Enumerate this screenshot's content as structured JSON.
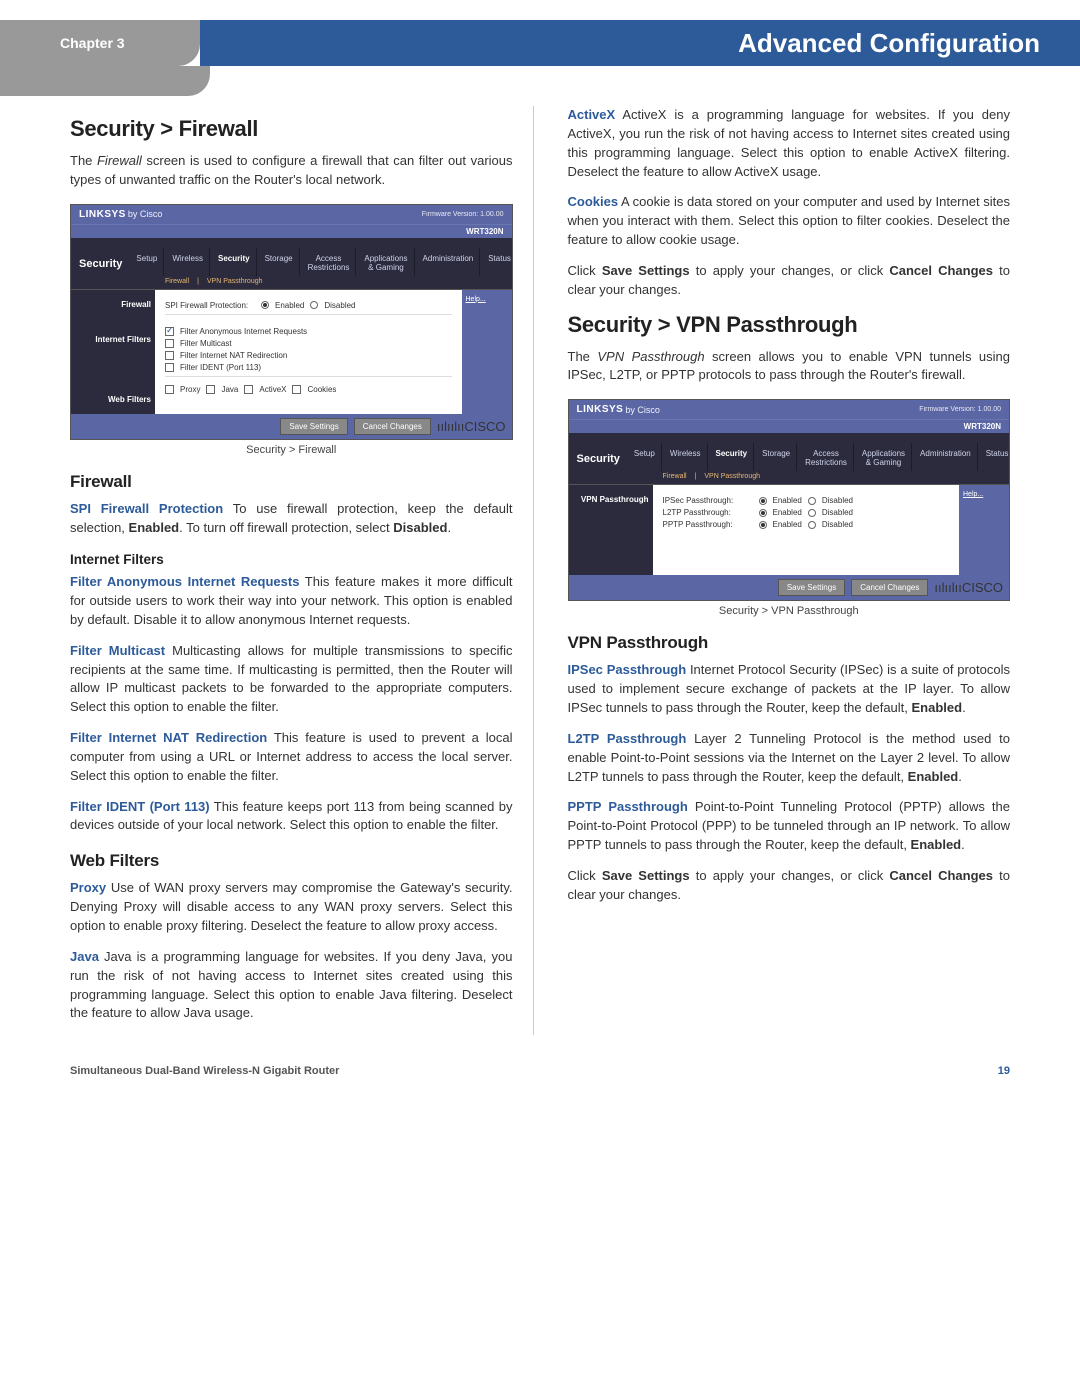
{
  "header": {
    "chapter": "Chapter 3",
    "title": "Advanced Configuration"
  },
  "left": {
    "h1": "Security > Firewall",
    "intro_a": "The ",
    "intro_em": "Firewall",
    "intro_b": " screen is used to configure a firewall that can filter out various types of unwanted traffic on the Router's local network.",
    "fig": {
      "brand": "LINKSYS",
      "by": "by Cisco",
      "fw": "Firmware Version: 1.00.00",
      "model": "WRT320N",
      "left_lbl": "Security",
      "tabs": [
        "Setup",
        "Wireless",
        "Security",
        "Storage",
        "Access Restrictions",
        "Applications & Gaming",
        "Administration",
        "Status"
      ],
      "subnav": [
        "Firewall",
        "|",
        "VPN Passthrough"
      ],
      "side": [
        "Firewall",
        "Internet Filters",
        "Web Filters"
      ],
      "spi_label": "SPI Firewall Protection:",
      "enabled": "Enabled",
      "disabled": "Disabled",
      "if1": "Filter Anonymous Internet Requests",
      "if2": "Filter Multicast",
      "if3": "Filter Internet NAT Redirection",
      "if4": "Filter IDENT (Port 113)",
      "wf": [
        "Proxy",
        "Java",
        "ActiveX",
        "Cookies"
      ],
      "help": "Help...",
      "save": "Save Settings",
      "cancel": "Cancel Changes",
      "cisco": "CISCO",
      "caption": "Security > Firewall"
    },
    "h2_firewall": "Firewall",
    "spi_term": "SPI Firewall Protection",
    "spi_body_a": " To use firewall protection, keep the default selection, ",
    "spi_en": "Enabled",
    "spi_body_b": ". To turn off firewall protection, select ",
    "spi_dis": "Disabled",
    "spi_body_c": ".",
    "h3_if": "Internet Filters",
    "fair_term": "Filter Anonymous Internet Requests",
    "fair_body": " This feature makes it more difficult for outside users to work their way into your network. This option is enabled by default. Disable it to allow anonymous Internet requests.",
    "fm_term": "Filter Multicast",
    "fm_body": " Multicasting allows for multiple transmissions to specific recipients at the same time. If multicasting is permitted, then the Router will allow IP multicast packets to be forwarded to the appropriate computers. Select this option to enable the filter.",
    "fnat_term": "Filter Internet NAT Redirection",
    "fnat_body": " This feature is used to prevent a local computer from using a URL or Internet address to access the local server. Select this option to enable the filter.",
    "fident_term": "Filter IDENT (Port 113)",
    "fident_body": " This feature keeps port 113 from being scanned by devices outside of your local network. Select this option to enable the filter.",
    "h2_wf": "Web Filters",
    "proxy_term": "Proxy",
    "proxy_body": " Use of WAN proxy servers may compromise the Gateway's security. Denying Proxy will disable access to any WAN proxy servers. Select this option to enable proxy filtering. Deselect the feature to allow proxy access.",
    "java_term": "Java",
    "java_body": " Java is a programming language for websites. If you deny Java, you run the risk of not having access to Internet sites created using this programming language. Select this option to enable Java filtering. Deselect the feature to allow Java usage."
  },
  "right": {
    "activex_term": "ActiveX",
    "activex_body": " ActiveX is a programming language for websites. If you deny ActiveX, you run the risk of not having access to Internet sites created using this programming language. Select this option to enable ActiveX filtering. Deselect the feature to allow ActiveX usage.",
    "cookies_term": "Cookies",
    "cookies_body": " A cookie is data stored on your computer and used by Internet sites when you interact with them. Select this option to filter cookies. Deselect the feature to allow cookie usage.",
    "save_a": "Click ",
    "save_b": "Save Settings",
    "save_c": " to apply your changes, or click ",
    "save_d": "Cancel Changes",
    "save_e": " to clear your changes.",
    "h1": "Security > VPN Passthrough",
    "intro_a": "The ",
    "intro_em": "VPN Passthrough",
    "intro_b": " screen allows you to enable VPN tunnels using IPSec, L2TP, or PPTP protocols to pass through the Router's firewall.",
    "fig": {
      "brand": "LINKSYS",
      "by": "by Cisco",
      "fw": "Firmware Version: 1.00.00",
      "model": "WRT320N",
      "left_lbl": "Security",
      "tabs": [
        "Setup",
        "Wireless",
        "Security",
        "Storage",
        "Access Restrictions",
        "Applications & Gaming",
        "Administration",
        "Status"
      ],
      "subnav": [
        "Firewall",
        "|",
        "VPN Passthrough"
      ],
      "side": [
        "VPN Passthrough"
      ],
      "rows": [
        {
          "label": "IPSec Passthrough:"
        },
        {
          "label": "L2TP Passthrough:"
        },
        {
          "label": "PPTP Passthrough:"
        }
      ],
      "enabled": "Enabled",
      "disabled": "Disabled",
      "help": "Help...",
      "save": "Save Settings",
      "cancel": "Cancel Changes",
      "cisco": "CISCO",
      "caption": "Security > VPN Passthrough"
    },
    "h2": "VPN Passthrough",
    "ipsec_term": "IPSec Passthrough",
    "ipsec_body_a": " Internet Protocol Security (IPSec) is a suite of protocols used to implement secure exchange of packets at the IP layer. To allow IPSec tunnels to pass through the Router, keep the default, ",
    "ipsec_en": "Enabled",
    "ipsec_body_b": ".",
    "l2tp_term": "L2TP Passthrough",
    "l2tp_body_a": " Layer 2 Tunneling Protocol is the method used to enable Point-to-Point sessions via the Internet on the Layer 2 level. To allow L2TP tunnels to pass through the Router, keep the default, ",
    "l2tp_en": "Enabled",
    "l2tp_body_b": ".",
    "pptp_term": "PPTP Passthrough",
    "pptp_body_a": " Point-to-Point Tunneling Protocol (PPTP) allows the Point-to-Point Protocol (PPP) to be tunneled through an IP network. To allow PPTP tunnels to pass through the Router, keep the default, ",
    "pptp_en": "Enabled",
    "pptp_body_b": "."
  },
  "footer": {
    "left": "Simultaneous Dual-Band Wireless-N Gigabit Router",
    "right": "19"
  }
}
